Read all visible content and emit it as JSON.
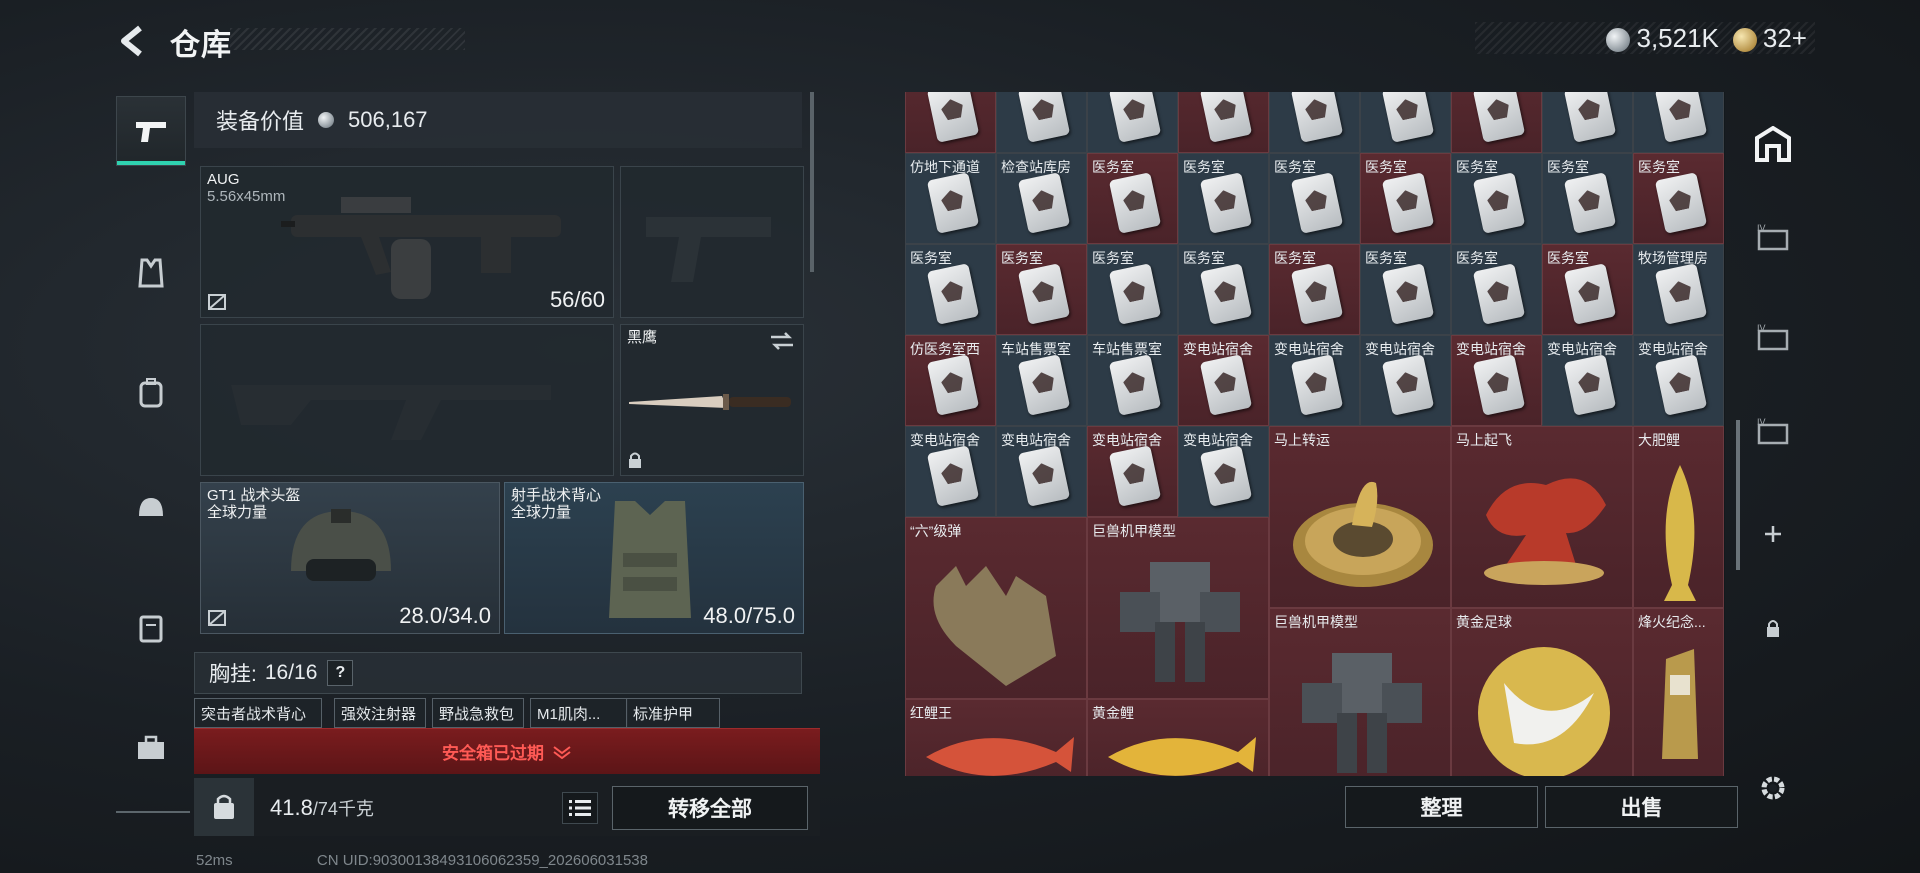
{
  "header": {
    "title": "仓库",
    "currency_silver": "3,521K",
    "currency_gold": "32+"
  },
  "loadout": {
    "value_label": "装备价值",
    "value": "506,167",
    "primary": {
      "name": "AUG",
      "caliber": "5.56x45mm",
      "ammo": "56/60"
    },
    "melee": {
      "name": "黑鹰"
    },
    "helmet": {
      "name": "GT1 战术头盔",
      "brand": "全球力量",
      "durability": "28.0/34.0"
    },
    "vest": {
      "name": "射手战术背心",
      "brand": "全球力量",
      "durability": "48.0/75.0"
    },
    "chest_rig_label": "胸挂:",
    "chest_rig_count": "16/16",
    "chest_help": "?",
    "chips": [
      "突击者战术背心",
      "强效注射器",
      "野战急救包",
      "M1肌肉...",
      "标准护甲"
    ],
    "safebox_text": "安全箱已过期",
    "weight": "41.8",
    "weight_max": "/74千克",
    "transfer_all": "转移全部"
  },
  "stash": {
    "rows": [
      [
        "",
        "",
        "",
        "",
        "",
        "",
        "",
        "",
        ""
      ],
      [
        "仿地下通道",
        "检查站库房",
        "医务室",
        "医务室",
        "医务室",
        "医务室",
        "医务室",
        "医务室",
        "医务室"
      ],
      [
        "医务室",
        "医务室",
        "医务室",
        "医务室",
        "医务室",
        "医务室",
        "医务室",
        "医务室",
        "牧场管理房"
      ],
      [
        "仿医务室西",
        "车站售票室",
        "车站售票室",
        "变电站宿舍",
        "变电站宿舍",
        "变电站宿舍",
        "变电站宿舍",
        "变电站宿舍",
        "变电站宿舍"
      ],
      [
        "变电站宿舍",
        "变电站宿舍",
        "变电站宿舍",
        "变电站宿舍"
      ]
    ],
    "big_items": {
      "mashang_zhuanyun": "马上转运",
      "mashang_qifei": "马上起飞",
      "da_feili": "大肥鲤",
      "liu_ji_dan": "“六”级弹",
      "mecha_model_1": "巨兽机甲模型",
      "mecha_model_2": "巨兽机甲模型",
      "golden_football": "黄金足球",
      "beacon_memorial": "烽火纪念...",
      "red_carp_king": "红鲤王",
      "golden_carp": "黄金鲤"
    },
    "sort_button": "整理",
    "sell_button": "出售"
  },
  "footer": {
    "ping": "52ms",
    "uid": "CN UID:9030013849310606235­9_202606031538"
  },
  "colors": {
    "accent_teal": "#2fd2b0",
    "warning_red": "#ff5a55",
    "red_cell": "#5a2a30",
    "blue_cell": "#2d3b47"
  }
}
